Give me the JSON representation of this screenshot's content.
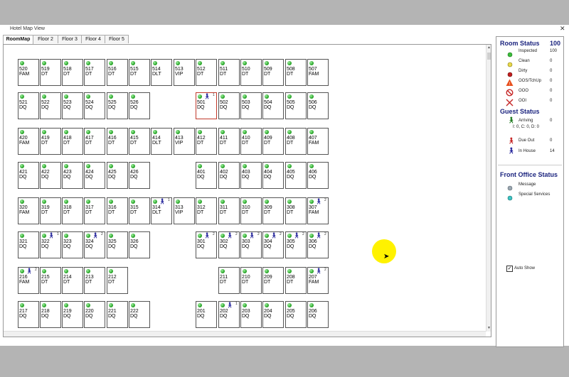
{
  "window": {
    "title": "Hotel Map View",
    "close": "✕"
  },
  "tabs": [
    "RoomMap",
    "Floor 2",
    "Floor 3",
    "Floor 4",
    "Floor 5"
  ],
  "rooms": [
    {
      "n": "520",
      "t": "FAM"
    },
    {
      "n": "519",
      "t": "DT"
    },
    {
      "n": "518",
      "t": "DT"
    },
    {
      "n": "517",
      "t": "DT"
    },
    {
      "n": "516",
      "t": "DT"
    },
    {
      "n": "515",
      "t": "DT"
    },
    {
      "n": "514",
      "t": "DLT"
    },
    {
      "n": "513",
      "t": "VIP"
    },
    {
      "n": "512",
      "t": "DT"
    },
    {
      "n": "511",
      "t": "DT"
    },
    {
      "n": "510",
      "t": "DT"
    },
    {
      "n": "509",
      "t": "DT"
    },
    {
      "n": "508",
      "t": "DT"
    },
    {
      "n": "507",
      "t": "FAM"
    },
    {
      "n": "521",
      "t": "DQ"
    },
    {
      "n": "522",
      "t": "DQ"
    },
    {
      "n": "523",
      "t": "DQ"
    },
    {
      "n": "524",
      "t": "DQ"
    },
    {
      "n": "525",
      "t": "DQ"
    },
    {
      "n": "526",
      "t": "DQ"
    },
    {
      "n": "501",
      "t": "DQ",
      "g": "1"
    },
    {
      "n": "502",
      "t": "DQ"
    },
    {
      "n": "503",
      "t": "DQ"
    },
    {
      "n": "504",
      "t": "DQ"
    },
    {
      "n": "505",
      "t": "DQ"
    },
    {
      "n": "506",
      "t": "DQ"
    },
    {
      "n": "420",
      "t": "FAM"
    },
    {
      "n": "419",
      "t": "DT"
    },
    {
      "n": "418",
      "t": "DT"
    },
    {
      "n": "417",
      "t": "DT"
    },
    {
      "n": "416",
      "t": "DT"
    },
    {
      "n": "415",
      "t": "DT"
    },
    {
      "n": "414",
      "t": "DLT"
    },
    {
      "n": "413",
      "t": "VIP"
    },
    {
      "n": "412",
      "t": "DT"
    },
    {
      "n": "411",
      "t": "DT"
    },
    {
      "n": "410",
      "t": "DT"
    },
    {
      "n": "409",
      "t": "DT"
    },
    {
      "n": "408",
      "t": "DT"
    },
    {
      "n": "407",
      "t": "FAM"
    },
    {
      "n": "421",
      "t": "DQ"
    },
    {
      "n": "422",
      "t": "DQ"
    },
    {
      "n": "423",
      "t": "DQ"
    },
    {
      "n": "424",
      "t": "DQ"
    },
    {
      "n": "425",
      "t": "DQ"
    },
    {
      "n": "426",
      "t": "DQ"
    },
    {
      "n": "401",
      "t": "DQ"
    },
    {
      "n": "402",
      "t": "DQ"
    },
    {
      "n": "403",
      "t": "DQ"
    },
    {
      "n": "404",
      "t": "DQ"
    },
    {
      "n": "405",
      "t": "DQ"
    },
    {
      "n": "406",
      "t": "DQ"
    },
    {
      "n": "320",
      "t": "FAM"
    },
    {
      "n": "319",
      "t": "DT"
    },
    {
      "n": "318",
      "t": "DT"
    },
    {
      "n": "317",
      "t": "DT"
    },
    {
      "n": "316",
      "t": "DT"
    },
    {
      "n": "315",
      "t": "DT"
    },
    {
      "n": "314",
      "t": "DLT",
      "g": "1"
    },
    {
      "n": "313",
      "t": "VIP"
    },
    {
      "n": "312",
      "t": "DT"
    },
    {
      "n": "311",
      "t": "DT"
    },
    {
      "n": "310",
      "t": "DT"
    },
    {
      "n": "309",
      "t": "DT"
    },
    {
      "n": "308",
      "t": "DT"
    },
    {
      "n": "307",
      "t": "FAM",
      "g": "2"
    },
    {
      "n": "321",
      "t": "DQ"
    },
    {
      "n": "322",
      "t": "DQ",
      "g": "1"
    },
    {
      "n": "323",
      "t": "DQ"
    },
    {
      "n": "324",
      "t": "DQ",
      "g": "2"
    },
    {
      "n": "325",
      "t": "DQ"
    },
    {
      "n": "326",
      "t": "DQ"
    },
    {
      "n": "301",
      "t": "DQ",
      "g": "2"
    },
    {
      "n": "302",
      "t": "DQ",
      "g": "2"
    },
    {
      "n": "303",
      "t": "DQ",
      "g": "2"
    },
    {
      "n": "304",
      "t": "DQ",
      "g": "2"
    },
    {
      "n": "305",
      "t": "DQ",
      "g": "2"
    },
    {
      "n": "306",
      "t": "DQ",
      "g": "2"
    },
    {
      "n": "216",
      "t": "FAM",
      "g": "2"
    },
    {
      "n": "215",
      "t": "DT"
    },
    {
      "n": "214",
      "t": "DT"
    },
    {
      "n": "213",
      "t": "DT"
    },
    {
      "n": "212",
      "t": "DT"
    },
    {
      "n": "211",
      "t": "DT"
    },
    {
      "n": "210",
      "t": "DT"
    },
    {
      "n": "209",
      "t": "DT"
    },
    {
      "n": "208",
      "t": "DT"
    },
    {
      "n": "207",
      "t": "FAM",
      "g": "2"
    },
    {
      "n": "217",
      "t": "DQ"
    },
    {
      "n": "218",
      "t": "DQ"
    },
    {
      "n": "219",
      "t": "DQ"
    },
    {
      "n": "220",
      "t": "DQ"
    },
    {
      "n": "221",
      "t": "DQ"
    },
    {
      "n": "222",
      "t": "DQ"
    },
    {
      "n": "201",
      "t": "DQ"
    },
    {
      "n": "202",
      "t": "DQ",
      "g": "1"
    },
    {
      "n": "203",
      "t": "DQ"
    },
    {
      "n": "204",
      "t": "DQ"
    },
    {
      "n": "205",
      "t": "DQ"
    },
    {
      "n": "206",
      "t": "DQ"
    }
  ],
  "room_status": {
    "title": "Room Status",
    "total": "100",
    "items": [
      {
        "label": "Inspected",
        "value": "100",
        "icon": "green-dot-icon"
      },
      {
        "label": "Clean",
        "value": "0",
        "icon": "yellow-dot-icon"
      },
      {
        "label": "Dirty",
        "value": "0",
        "icon": "red-dot-icon"
      },
      {
        "label": "OOS/TchUp",
        "value": "0",
        "icon": "warning-icon"
      },
      {
        "label": "OOO",
        "value": "0",
        "icon": "no-entry-icon"
      },
      {
        "label": "OOI",
        "value": "0",
        "icon": "cross-icon"
      }
    ]
  },
  "guest_status": {
    "title": "Guest Status",
    "arriving": {
      "label": "Arriving",
      "value": "0",
      "detail": "I: 0, C: 0, D: 0"
    },
    "due_out": {
      "label": "Due Out",
      "value": "0"
    },
    "in_house": {
      "label": "In House",
      "value": "14"
    }
  },
  "front_office": {
    "title": "Front Office Status",
    "message": "Message",
    "special": "Special Services"
  },
  "auto_show": {
    "label": "Auto Show",
    "checked": true
  },
  "colors": {
    "heading": "#1a237e",
    "room_border": "#555555",
    "selected_border": "#c0392b",
    "inspected": "#1c9c1c"
  }
}
